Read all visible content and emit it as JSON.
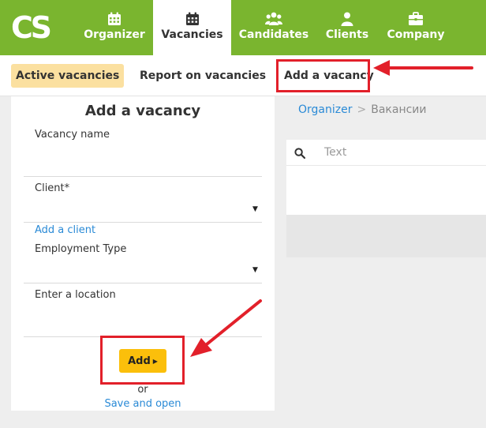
{
  "logo": {
    "text": "CS"
  },
  "nav": {
    "items": [
      {
        "label": "Organizer",
        "icon": "calendar-icon"
      },
      {
        "label": "Vacancies",
        "icon": "calendar-icon",
        "active": true
      },
      {
        "label": "Candidates",
        "icon": "users-icon"
      },
      {
        "label": "Clients",
        "icon": "person-icon"
      },
      {
        "label": "Company",
        "icon": "briefcase-icon"
      }
    ]
  },
  "subnav": {
    "tabs": [
      {
        "label": "Active vacancies",
        "active": true
      },
      {
        "label": "Report on vacancies"
      },
      {
        "label": "Add a vacancy",
        "highlighted": true
      }
    ]
  },
  "form": {
    "title": "Add a vacancy",
    "vacancy_name_label": "Vacancy name",
    "client_label": "Client*",
    "add_client_link": "Add a client",
    "employment_type_label": "Employment Type",
    "location_label": "Enter a location",
    "add_button": "Add",
    "or_text": "or",
    "save_and_open_link": "Save and open"
  },
  "breadcrumb": {
    "root": "Organizer",
    "separator": ">",
    "current": "Вакансии"
  },
  "search": {
    "placeholder": "Text"
  },
  "colors": {
    "brand_green": "#7ab52f",
    "accent_yellow": "#fbbf0b",
    "active_tab_bg": "#fbe0a0",
    "link_blue": "#2a8ad6",
    "annotation_red": "#e2202a"
  }
}
